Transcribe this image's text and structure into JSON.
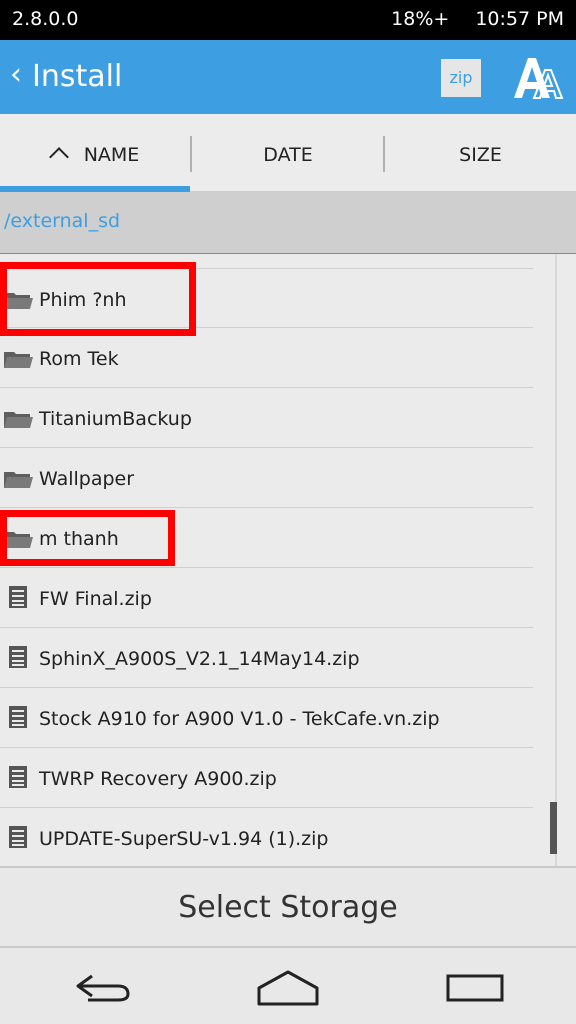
{
  "status_bar": {
    "version": "2.8.0.0",
    "battery": "18%+",
    "time": "10:57 PM"
  },
  "header": {
    "back_glyph": "‹",
    "title": "Install",
    "zip_label": "zip",
    "accent": "#3d9fe2"
  },
  "sort_tabs": [
    {
      "label": "NAME",
      "active": true
    },
    {
      "label": "DATE",
      "active": false
    },
    {
      "label": "SIZE",
      "active": false
    }
  ],
  "path": "/external_sd",
  "files": [
    {
      "label": "Phim ?nh",
      "type": "folder",
      "icon": "folder-icon",
      "highlighted": true
    },
    {
      "label": "Rom Tek",
      "type": "folder",
      "icon": "folder-icon",
      "highlighted": false
    },
    {
      "label": "TitaniumBackup",
      "type": "folder",
      "icon": "folder-icon",
      "highlighted": false
    },
    {
      "label": "Wallpaper",
      "type": "folder",
      "icon": "folder-icon",
      "highlighted": false
    },
    {
      "label": "m thanh",
      "type": "folder",
      "icon": "folder-icon",
      "highlighted": true
    },
    {
      "label": "FW Final.zip",
      "type": "file",
      "icon": "file-icon",
      "highlighted": false
    },
    {
      "label": "SphinX_A900S_V2.1_14May14.zip",
      "type": "file",
      "icon": "file-icon",
      "highlighted": false
    },
    {
      "label": "Stock A910 for A900 V1.0 - TekCafe.vn.zip",
      "type": "file",
      "icon": "file-icon",
      "highlighted": false
    },
    {
      "label": "TWRP Recovery A900.zip",
      "type": "file",
      "icon": "file-icon",
      "highlighted": false
    },
    {
      "label": "UPDATE-SuperSU-v1.94 (1).zip",
      "type": "file",
      "icon": "file-icon",
      "highlighted": false
    }
  ],
  "select_storage_label": "Select Storage",
  "highlight_color": "#ff0000"
}
